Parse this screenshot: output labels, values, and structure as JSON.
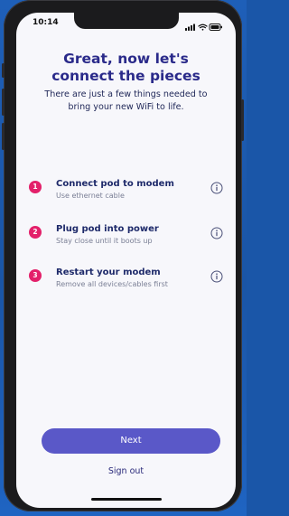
{
  "status_bar": {
    "time": "10:14"
  },
  "header": {
    "title_line1": "Great, now let's",
    "title_line2": "connect the pieces",
    "subtitle_line1": "There are just a few things needed to",
    "subtitle_line2": "bring your new WiFi to life."
  },
  "steps": [
    {
      "number": "1",
      "title": "Connect pod to modem",
      "subtitle": "Use ethernet cable"
    },
    {
      "number": "2",
      "title": "Plug pod into power",
      "subtitle": "Stay close until it boots up"
    },
    {
      "number": "3",
      "title": "Restart your modem",
      "subtitle": "Remove all devices/cables first"
    }
  ],
  "actions": {
    "next_label": "Next",
    "signout_label": "Sign out"
  },
  "colors": {
    "accent": "#5a58c8",
    "step_badge": "#e3206a",
    "title": "#2a2a8a"
  },
  "icons": {
    "info": "info-icon",
    "signal": "signal-icon",
    "wifi": "wifi-icon",
    "battery": "battery-icon"
  }
}
